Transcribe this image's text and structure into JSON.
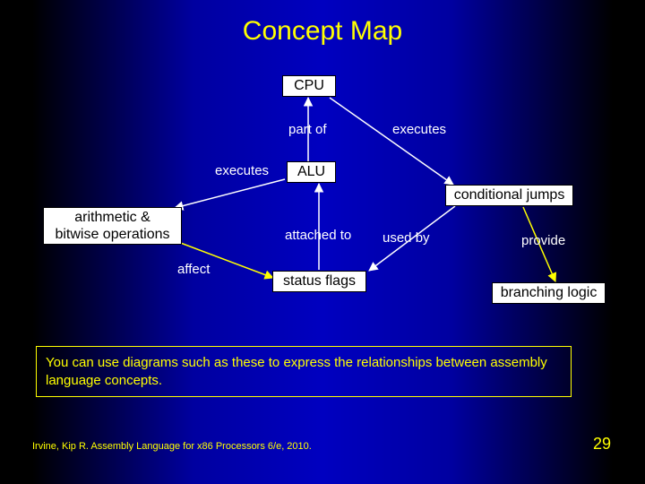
{
  "title": "Concept Map",
  "nodes": {
    "cpu": "CPU",
    "alu": "ALU",
    "arith": "arithmetic & bitwise operations",
    "cond": "conditional jumps",
    "status": "status flags",
    "branch": "branching logic"
  },
  "edges": {
    "part_of": "part of",
    "executes_right": "executes",
    "executes_left": "executes",
    "attached_to": "attached to",
    "used_by": "used by",
    "provide": "provide",
    "affect": "affect"
  },
  "note": "You can use diagrams such as these to express the relationships between assembly language concepts.",
  "footer": "Irvine, Kip R. Assembly Language for x86 Processors 6/e, 2010.",
  "page": "29"
}
